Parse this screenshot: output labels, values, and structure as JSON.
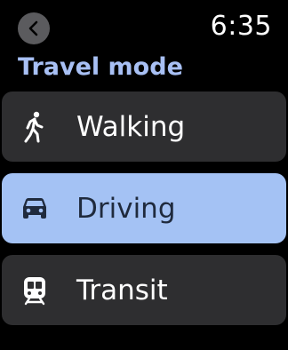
{
  "status_bar": {
    "time": "6:35",
    "back_icon": "chevron-left-icon"
  },
  "header": {
    "title": "Travel mode"
  },
  "options": [
    {
      "label": "Walking",
      "icon": "walking-icon",
      "selected": false
    },
    {
      "label": "Driving",
      "icon": "car-icon",
      "selected": true
    },
    {
      "label": "Transit",
      "icon": "train-icon",
      "selected": false
    }
  ],
  "colors": {
    "background": "#000000",
    "title": "#a8c0f4",
    "option_bg": "#2e2e30",
    "selected_bg": "#a4c2f4",
    "back_button_bg": "#5b5b5e"
  }
}
